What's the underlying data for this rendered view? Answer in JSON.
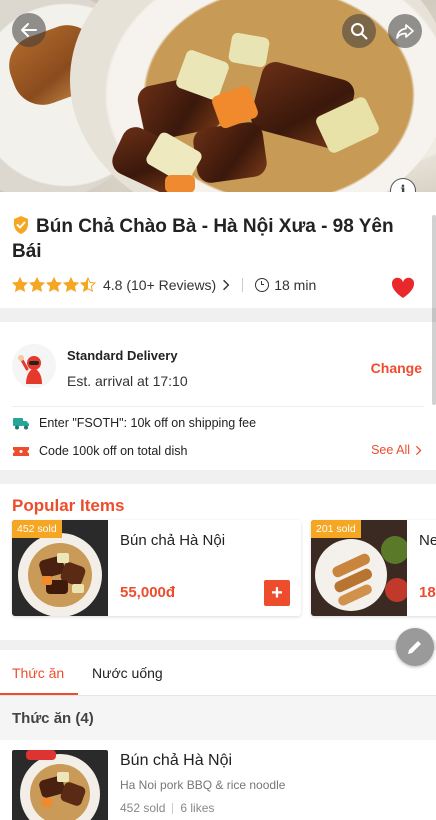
{
  "header": {
    "back_icon": "arrow-left-icon",
    "search_icon": "search-icon",
    "share_icon": "share-icon",
    "info_icon": "info-icon"
  },
  "restaurant": {
    "name": "Bún Chả Chào Bà - Hà Nội Xưa - 98 Yên Bái",
    "verified_icon": "shield-check-icon",
    "rating_stars": 4.5,
    "rating_text": "4.8 (10+ Reviews)",
    "delivery_time": "18 min",
    "favorite": true
  },
  "delivery": {
    "title": "Standard Delivery",
    "eta": "Est. arrival at 17:10",
    "change_label": "Change",
    "promos": [
      {
        "icon": "truck-icon",
        "text": "Enter \"FSOTH\": 10k off on shipping fee"
      },
      {
        "icon": "coupon-icon",
        "text": "Code 100k off on total dish"
      }
    ],
    "see_all_label": "See All"
  },
  "popular": {
    "title": "Popular Items",
    "items": [
      {
        "sold": "452 sold",
        "name": "Bún chả Hà Nội",
        "price": "55,000đ"
      },
      {
        "sold": "201 sold",
        "name": "Ne",
        "price": "18"
      }
    ]
  },
  "tabs": [
    {
      "label": "Thức ăn",
      "active": true
    },
    {
      "label": "Nước uống",
      "active": false
    }
  ],
  "menu": {
    "section_title": "Thức ăn (4)",
    "items": [
      {
        "name": "Bún chả Hà Nội",
        "desc": "Ha Noi pork BBQ & rice noodle",
        "sold": "452 sold",
        "likes": "6 likes"
      }
    ]
  },
  "colors": {
    "accent": "#ee4d2d",
    "star": "#f5a623",
    "sold_tag": "#f5a623"
  }
}
